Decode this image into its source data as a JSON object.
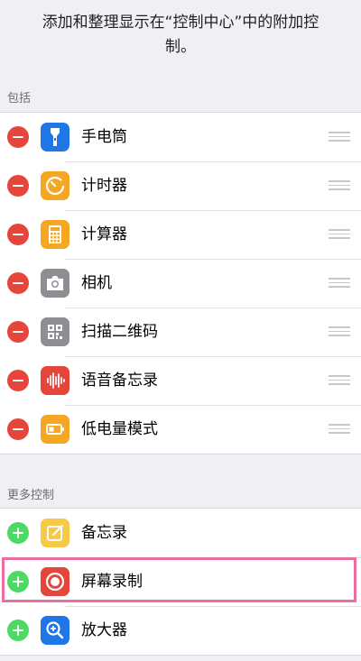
{
  "intro": {
    "text": "添加和整理显示在“控制中心”中的附加控制。"
  },
  "included": {
    "header": "包括",
    "items": [
      {
        "label": "手电筒",
        "icon": "flashlight-icon",
        "color": "#1f77e6"
      },
      {
        "label": "计时器",
        "icon": "timer-icon",
        "color": "#f5a623"
      },
      {
        "label": "计算器",
        "icon": "calculator-icon",
        "color": "#f5a623"
      },
      {
        "label": "相机",
        "icon": "camera-icon",
        "color": "#8e8e93"
      },
      {
        "label": "扫描二维码",
        "icon": "qr-code-icon",
        "color": "#8e8e93"
      },
      {
        "label": "语音备忘录",
        "icon": "voice-memo-icon",
        "color": "#e5453a"
      },
      {
        "label": "低电量模式",
        "icon": "battery-icon",
        "color": "#f5a623"
      }
    ]
  },
  "more": {
    "header": "更多控制",
    "items": [
      {
        "label": "备忘录",
        "icon": "notes-icon",
        "color": "#f7c948"
      },
      {
        "label": "屏幕录制",
        "icon": "screen-record-icon",
        "color": "#e5453a"
      },
      {
        "label": "放大器",
        "icon": "magnifier-icon",
        "color": "#1f77e6"
      }
    ]
  },
  "colors": {
    "remove": "#e5453a",
    "add": "#4cd964",
    "highlight": "#ea6fa0"
  }
}
